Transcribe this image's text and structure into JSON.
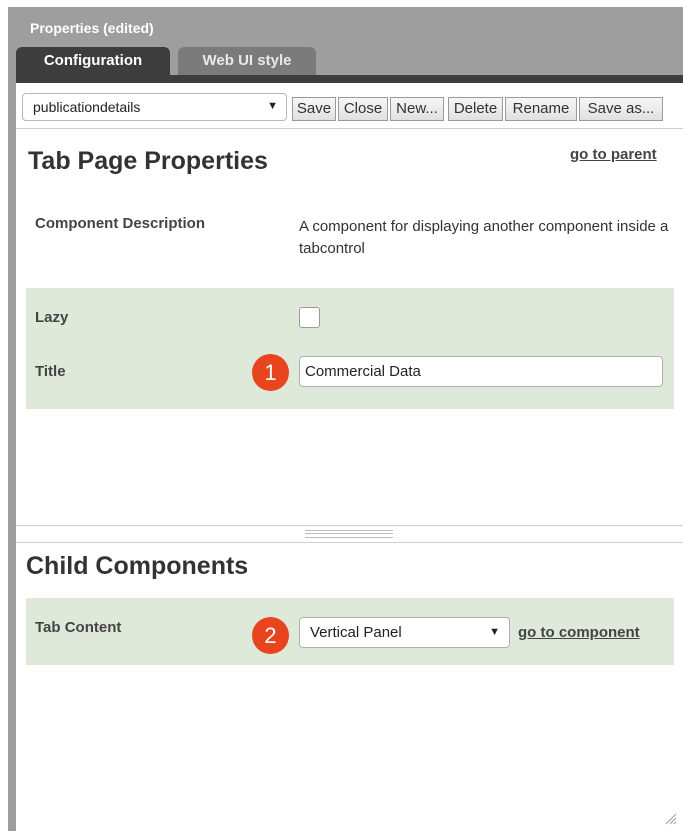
{
  "window": {
    "title": "Properties (edited)"
  },
  "tabs": [
    {
      "label": "Configuration",
      "active": true
    },
    {
      "label": "Web UI style",
      "active": false
    }
  ],
  "toolbar": {
    "component_select": {
      "value": "publicationdetails"
    },
    "buttons": [
      "Save",
      "Close",
      "New...",
      "Delete",
      "Rename",
      "Save as..."
    ]
  },
  "tab_page": {
    "heading": "Tab Page Properties",
    "parent_link": "go to parent",
    "description_label": "Component Description",
    "description_value": "A component for displaying another component inside a tabcontrol",
    "lazy_label": "Lazy",
    "lazy_checked": false,
    "title_label": "Title",
    "title_value": "Commercial Data",
    "callout_1": "1"
  },
  "child_components": {
    "heading": "Child Components",
    "tab_content_label": "Tab Content",
    "tab_content_value": "Vertical Panel",
    "component_link": "go to component",
    "callout_2": "2"
  },
  "colors": {
    "title_bar": "#9e9e9e",
    "active_tab": "#3d3d3d",
    "field_group_bg": "#dfe9d9",
    "callout": "#e8451f"
  }
}
